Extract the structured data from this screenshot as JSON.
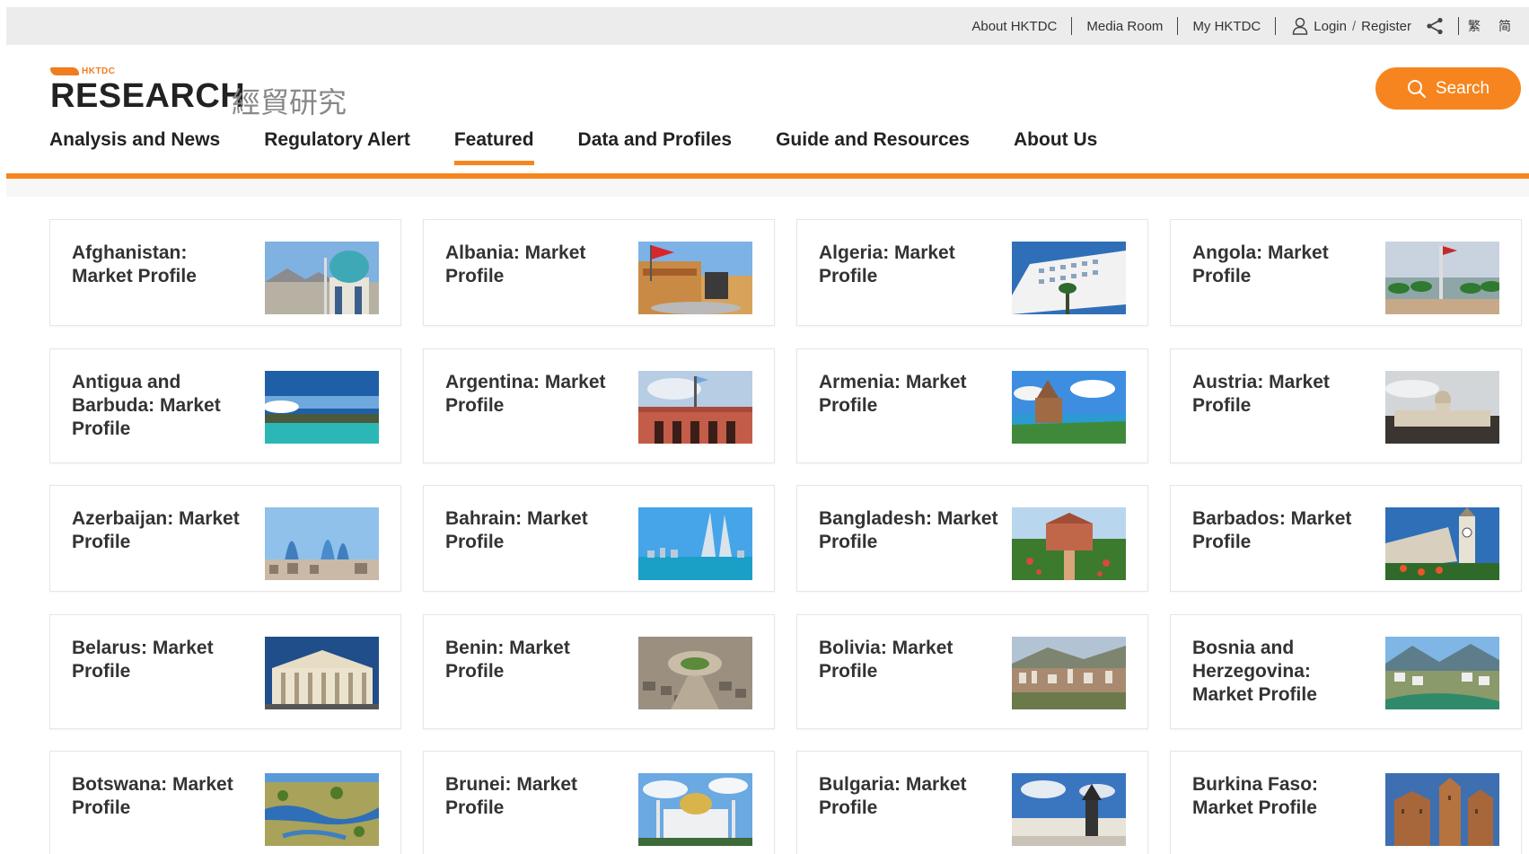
{
  "topbar": {
    "about": "About HKTDC",
    "media": "Media Room",
    "my": "My HKTDC",
    "login": "Login",
    "slash": "/",
    "register": "Register",
    "lang_tc": "繁",
    "lang_sc": "简"
  },
  "logo": {
    "hk": "HKTDC",
    "research": "RESEARCH",
    "zh": "經貿研究"
  },
  "search": {
    "label": "Search"
  },
  "nav": [
    {
      "label": "Analysis and News",
      "active": false
    },
    {
      "label": "Regulatory Alert",
      "active": false
    },
    {
      "label": "Featured",
      "active": true
    },
    {
      "label": "Data and Profiles",
      "active": false
    },
    {
      "label": "Guide and Resources",
      "active": false
    },
    {
      "label": "About Us",
      "active": false
    }
  ],
  "profiles": [
    {
      "title": "Afghanistan: Market Profile",
      "thumb": "mosque-dome"
    },
    {
      "title": "Albania: Market Profile",
      "thumb": "statue-square"
    },
    {
      "title": "Algeria: Market Profile",
      "thumb": "white-building"
    },
    {
      "title": "Angola: Market Profile",
      "thumb": "palm-bay"
    },
    {
      "title": "Antigua and Barbuda: Market Profile",
      "thumb": "coast-sea"
    },
    {
      "title": "Argentina: Market Profile",
      "thumb": "pink-palace"
    },
    {
      "title": "Armenia: Market Profile",
      "thumb": "lake-church"
    },
    {
      "title": "Austria: Market Profile",
      "thumb": "vienna-palace"
    },
    {
      "title": "Azerbaijan: Market Profile",
      "thumb": "flame-towers"
    },
    {
      "title": "Bahrain: Market Profile",
      "thumb": "trade-towers"
    },
    {
      "title": "Bangladesh: Market Profile",
      "thumb": "fort-garden"
    },
    {
      "title": "Barbados: Market Profile",
      "thumb": "clock-tower"
    },
    {
      "title": "Belarus: Market Profile",
      "thumb": "theatre-columns"
    },
    {
      "title": "Benin: Market Profile",
      "thumb": "roundabout"
    },
    {
      "title": "Bolivia: Market Profile",
      "thumb": "hill-city"
    },
    {
      "title": "Bosnia and Herzegovina: Market Profile",
      "thumb": "river-town"
    },
    {
      "title": "Botswana: Market Profile",
      "thumb": "delta"
    },
    {
      "title": "Brunei: Market Profile",
      "thumb": "golden-mosque"
    },
    {
      "title": "Bulgaria: Market Profile",
      "thumb": "monument"
    },
    {
      "title": "Burkina Faso: Market Profile",
      "thumb": "mud-mosque"
    }
  ],
  "colors": {
    "accent": "#f7851f",
    "text": "#333333",
    "topbar": "#ececec"
  }
}
